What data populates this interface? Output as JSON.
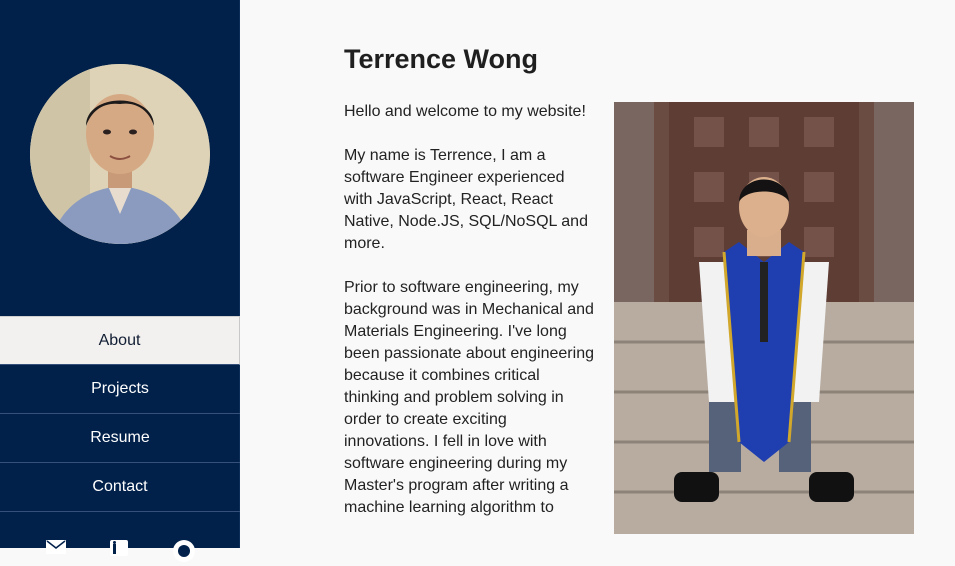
{
  "profile": {
    "name": "Terrence Wong"
  },
  "nav": {
    "items": [
      {
        "label": "About",
        "active": true
      },
      {
        "label": "Projects",
        "active": false
      },
      {
        "label": "Resume",
        "active": false
      },
      {
        "label": "Contact",
        "active": false
      }
    ]
  },
  "social": {
    "icons": [
      "email-icon",
      "linkedin-icon",
      "github-icon"
    ]
  },
  "bio": {
    "paragraphs": [
      "Hello and welcome to my website!",
      "My name is Terrence, I am a software Engineer experienced with JavaScript, React, React Native, Node.JS, SQL/NoSQL and more.",
      "Prior to software engineering, my background was in Mechanical and Materials Engineering. I've long been passionate about engineering because it combines critical thinking and problem solving in order to create exciting innovations. I fell in love with software engineering during my Master's program after writing a machine learning algorithm to"
    ]
  },
  "colors": {
    "sidebar": "#02214a",
    "active_nav": "#f2f1ef",
    "background": "#f9f9f9",
    "stole_blue": "#1f3fb0",
    "stole_gold": "#d1a72c"
  }
}
